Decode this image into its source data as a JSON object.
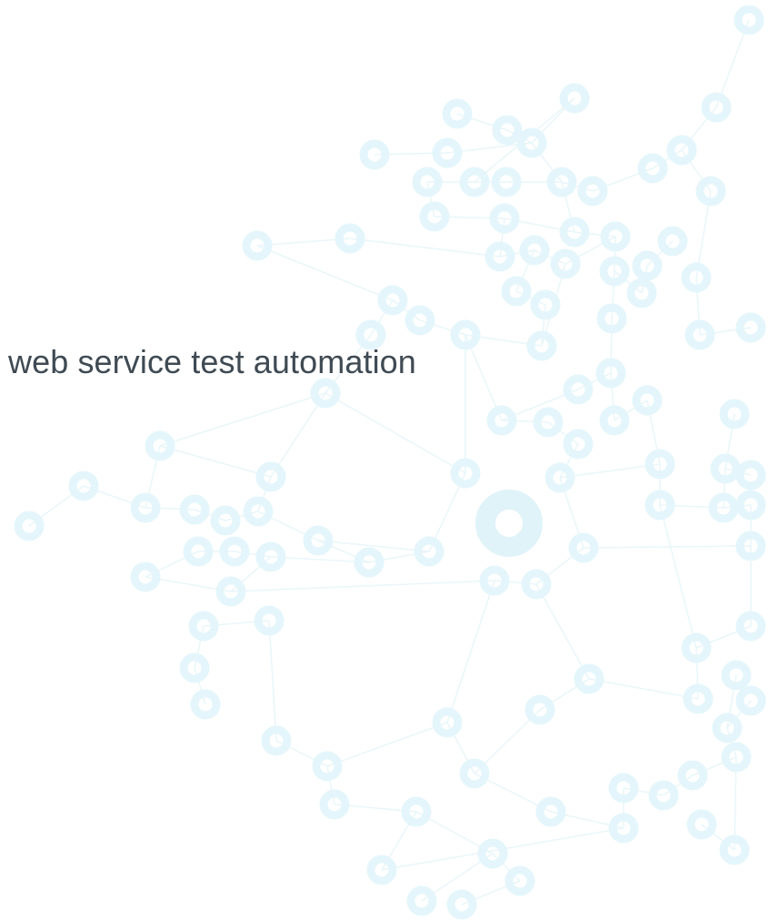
{
  "hero": {
    "tagline": "web service test automation"
  },
  "colors": {
    "background": "#ffffff",
    "tagline_text": "#3f4a53",
    "network_node": "#e4f6fb",
    "network_edge": "#e9f6f9",
    "network_hub": "#e0f3f9"
  },
  "icons": {
    "decoration": "network-graph-icon"
  }
}
